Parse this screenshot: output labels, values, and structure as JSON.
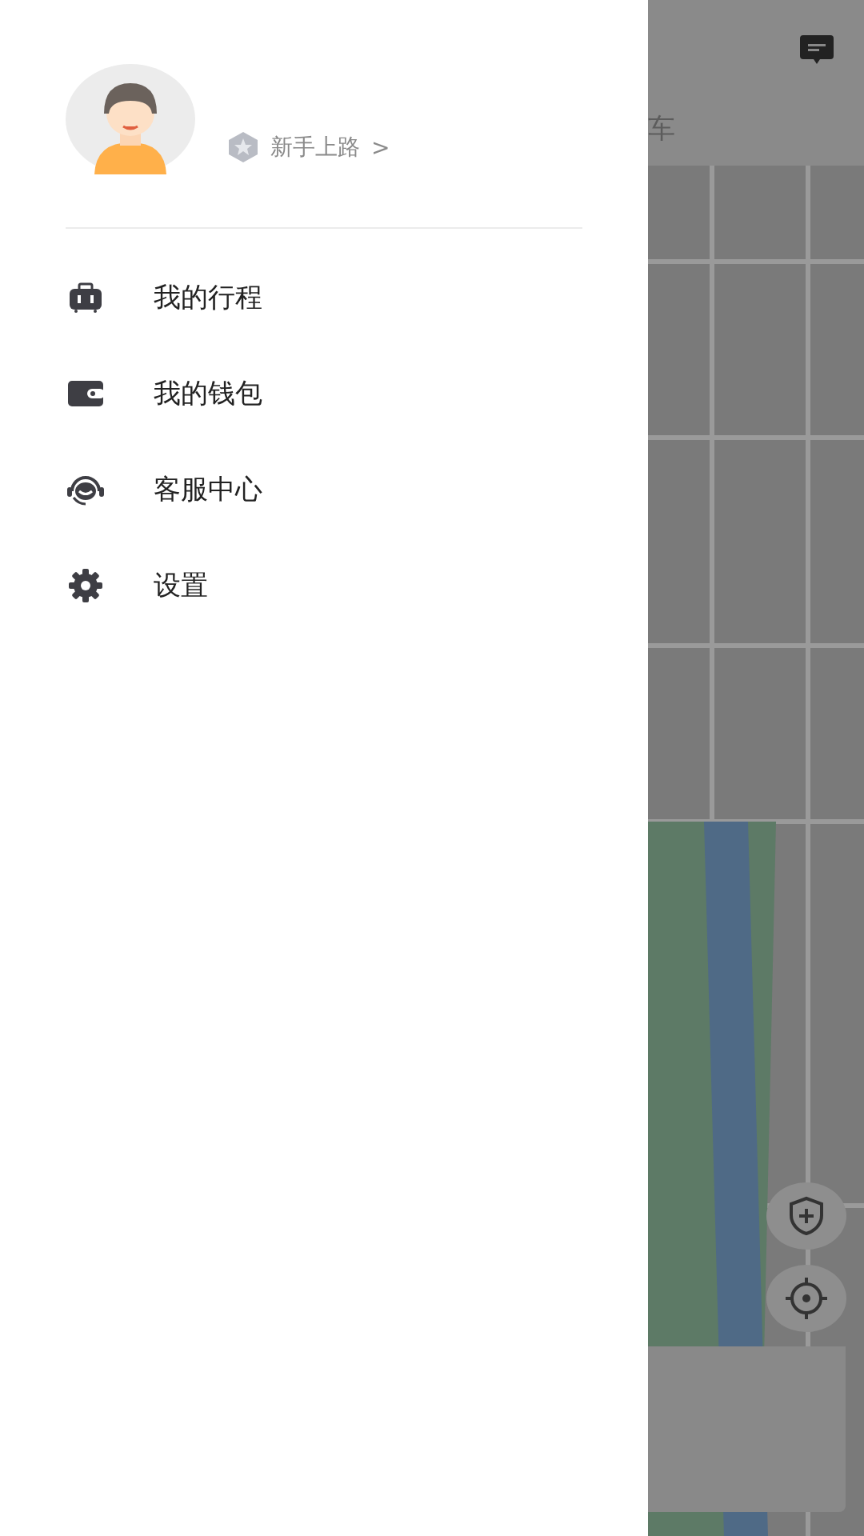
{
  "drawer": {
    "profile": {
      "level_badge": "新手上路",
      "chevron": ">"
    },
    "menu": [
      {
        "kind": "trips",
        "label": "我的行程"
      },
      {
        "kind": "wallet",
        "label": "我的钱包"
      },
      {
        "kind": "service",
        "label": "客服中心"
      },
      {
        "kind": "settings",
        "label": "设置"
      }
    ]
  },
  "background": {
    "tab_partial": "车"
  }
}
